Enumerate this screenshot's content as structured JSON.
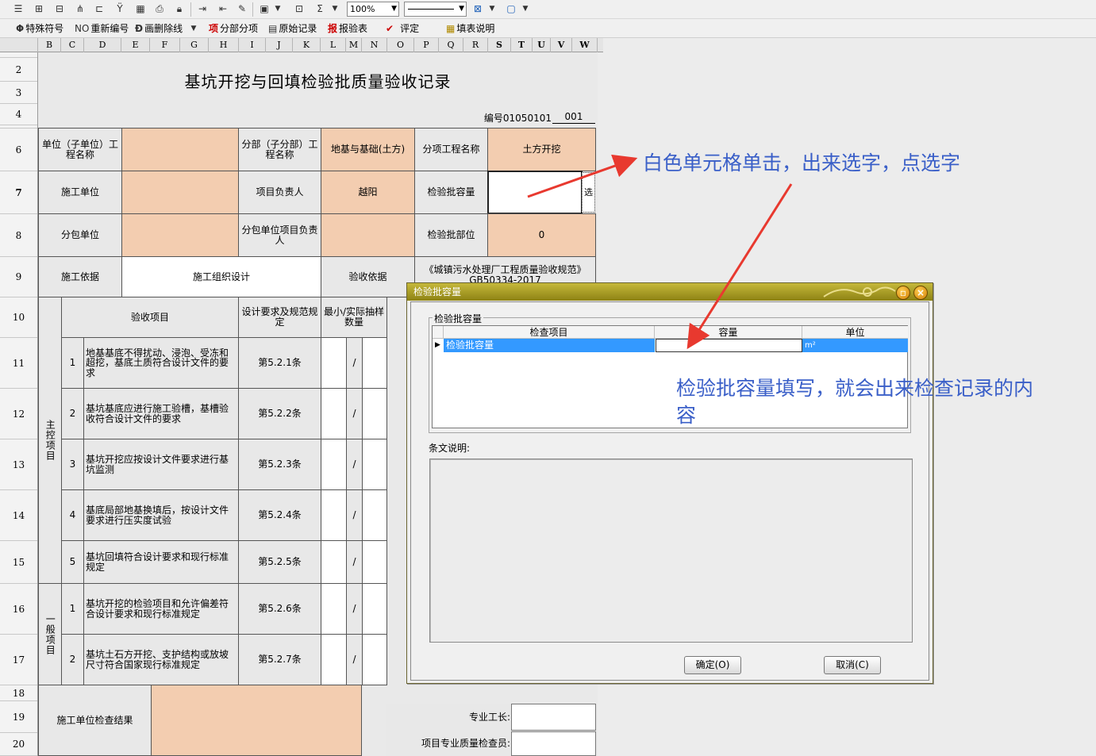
{
  "toolbar_top": {
    "zoom": "100%",
    "icons": [
      "insert-row-icon",
      "insert-col-icon",
      "insert-sheet-icon",
      "split-icon",
      "merge-icon",
      "filter-icon",
      "grid-icon",
      "print-icon",
      "lock-icon",
      "indent-icon",
      "outdent-icon",
      "brush-icon",
      "image-icon",
      "format-icon",
      "sum-icon",
      "border-icon",
      "fill-icon"
    ]
  },
  "toolbar_second": {
    "items": [
      {
        "icon": "Φ",
        "label": "特殊符号"
      },
      {
        "icon": "NO",
        "label": "重新编号"
      },
      {
        "icon": "Đ",
        "label": "画删除线"
      },
      {
        "icon": "项",
        "label": "分部分项"
      },
      {
        "icon": "▤",
        "label": "原始记录"
      },
      {
        "icon": "报",
        "label": "报验表"
      },
      {
        "icon": "✔",
        "label": "评定"
      },
      {
        "icon": "▦",
        "label": "填表说明"
      }
    ]
  },
  "columns": [
    "B",
    "C",
    "D",
    "E",
    "F",
    "G",
    "H",
    "I",
    "J",
    "K",
    "L",
    "M",
    "N",
    "O",
    "P",
    "Q",
    "R",
    "S",
    "T",
    "U",
    "V",
    "W"
  ],
  "rows": [
    "2",
    "3",
    "4",
    "6",
    "7",
    "8",
    "9",
    "10",
    "11",
    "12",
    "13",
    "14",
    "15",
    "16",
    "17",
    "18",
    "19",
    "20"
  ],
  "form": {
    "title": "基坑开挖与回填检验批质量验收记录",
    "code_label": "编号01050101",
    "code_value": "001",
    "unit_name_label": "单位（子单位）工程名称",
    "unit_name_value": "",
    "subdivision_label": "分部（子分部）工程名称",
    "subdivision_value": "地基与基础(土方)",
    "item_label": "分项工程名称",
    "item_value": "土方开挖",
    "construction_unit_label": "施工单位",
    "construction_unit_value": "",
    "project_manager_label": "项目负责人",
    "project_manager_value": "越阳",
    "capacity_label": "检验批容量",
    "capacity_value": "",
    "capacity_select": "选",
    "sub_unit_label": "分包单位",
    "sub_unit_value": "",
    "sub_manager_label": "分包单位项目负责人",
    "sub_manager_value": "",
    "batch_part_label": "检验批部位",
    "batch_part_value": "0",
    "basis_label": "施工依据",
    "basis_value": "施工组织设计",
    "acceptance_basis_label": "验收依据",
    "acceptance_basis_value": "《城镇污水处理厂工程质量验收规范》GB50334-2017",
    "header_item": "验收项目",
    "header_design": "设计要求及规范规定",
    "header_min": "最小/实际抽样数量",
    "main_group_label": "主控项目",
    "general_group_label": "一般项目",
    "items": [
      {
        "no": "1",
        "text": "地基基底不得扰动、浸泡、受冻和超挖，基底土质符合设计文件的要求",
        "clause": "第5.2.1条",
        "slash": "/"
      },
      {
        "no": "2",
        "text": "基坑基底应进行施工验槽，基槽验收符合设计文件的要求",
        "clause": "第5.2.2条",
        "slash": "/"
      },
      {
        "no": "3",
        "text": "基坑开挖应按设计文件要求进行基坑监测",
        "clause": "第5.2.3条",
        "slash": "/"
      },
      {
        "no": "4",
        "text": "基底局部地基换填后，按设计文件要求进行压实度试验",
        "clause": "第5.2.4条",
        "slash": "/"
      },
      {
        "no": "5",
        "text": "基坑回填符合设计要求和现行标准规定",
        "clause": "第5.2.5条",
        "slash": "/"
      },
      {
        "no": "1",
        "text": "基坑开挖的检验项目和允许偏差符合设计要求和现行标准规定",
        "clause": "第5.2.6条",
        "slash": "/"
      },
      {
        "no": "2",
        "text": "基坑土石方开挖、支护结构或放坡尺寸符合国家现行标准规定",
        "clause": "第5.2.7条",
        "slash": "/"
      }
    ],
    "check_result_label": "施工单位检查结果",
    "foreman_label": "专业工长:",
    "inspector_label": "项目专业质量检查员:"
  },
  "dialog": {
    "title": "检验批容量",
    "group_label": "检验批容量",
    "columns": [
      "检查项目",
      "容量",
      "单位"
    ],
    "row": {
      "item": "检验批容量",
      "capacity": "",
      "unit": "m²"
    },
    "note_label": "条文说明:",
    "ok_label": "确定(O)",
    "cancel_label": "取消(C)"
  },
  "annotations": {
    "top": "白色单元格单击，出来选字，点选字",
    "middle_line1": "检验批容量填写，就会出来检查记录的内",
    "middle_line2": "容"
  },
  "colors": {
    "orange_cell": "#f3cdb0",
    "annotation": "#3a5fc8",
    "arrow": "#e8392f",
    "dialog_title": "#a89b22",
    "selection": "#3399ff"
  }
}
